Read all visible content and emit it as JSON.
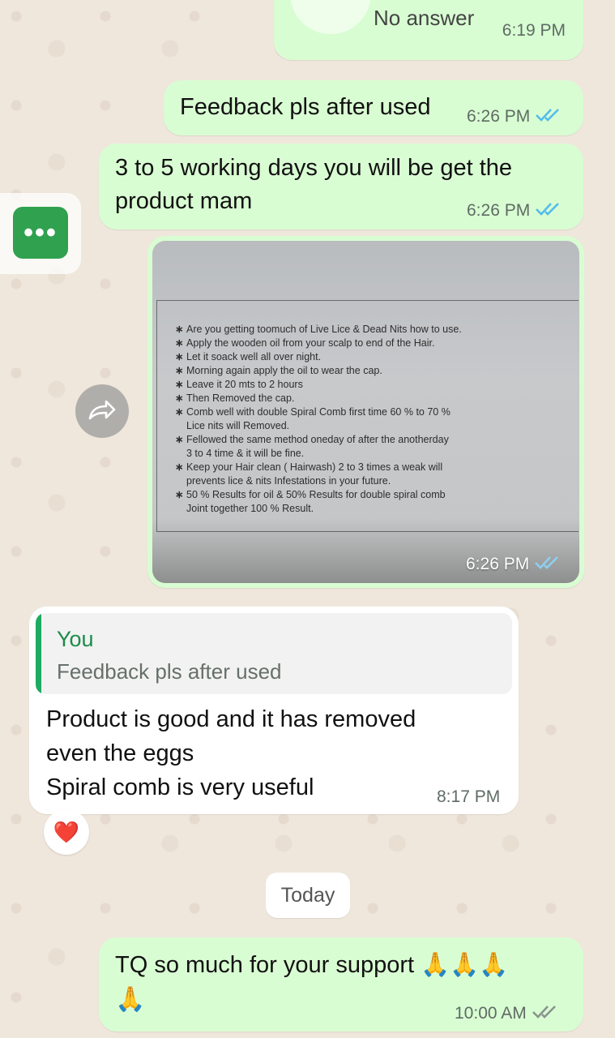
{
  "messages": {
    "call": {
      "label": "No answer",
      "time": "6:19 PM"
    },
    "feedback": {
      "text": "Feedback pls after used",
      "time": "6:26 PM"
    },
    "delivery": {
      "line1": "3 to 5 working days you will be get the",
      "line2": "product mam",
      "time": "6:26 PM"
    },
    "image": {
      "time": "6:26 PM",
      "lines": [
        "Are you getting toomuch of Live Lice & Dead Nits how to use.",
        "Apply the wooden oil from your scalp to end of the Hair.",
        "Let it soack well all over night.",
        "Morning again apply the oil to wear the cap.",
        "Leave it 20 mts to 2 hours",
        "Then Removed the cap.",
        "Comb well with double Spiral Comb first time 60 % to 70 %",
        "Lice nits will Removed.",
        "Fellowed the same method oneday of after the anotherday",
        "3 to 4 time & it will be fine.",
        "Keep your Hair clean ( Hairwash) 2 to 3 times a weak will",
        "prevents lice & nits Infestations in your future.",
        "50 % Results for oil & 50% Results for double spiral comb",
        "Joint together 100 % Result."
      ]
    },
    "reply": {
      "quote_author": "You",
      "quote_text": "Feedback pls after used",
      "line1": "Product is good and it has removed",
      "line2": "even the eggs",
      "line3": "Spiral comb is very useful",
      "time": "8:17 PM",
      "reaction": "❤️"
    },
    "date_separator": "Today",
    "thanks": {
      "text": "TQ so much for your support 🙏🙏🙏",
      "emoji_line2": "🙏",
      "time": "10:00 AM"
    }
  },
  "side_button": {
    "label": "•••"
  },
  "colors": {
    "outgoing_bubble": "#d9fdd3",
    "incoming_bubble": "#ffffff",
    "read_ticks": "#53bdeb",
    "delivered_ticks": "#8a948f",
    "accent_green": "#1daa61"
  },
  "icons": {
    "call": "video-call-icon",
    "ticks": "double-check-icon",
    "forward": "forward-icon",
    "more": "more-icon"
  }
}
